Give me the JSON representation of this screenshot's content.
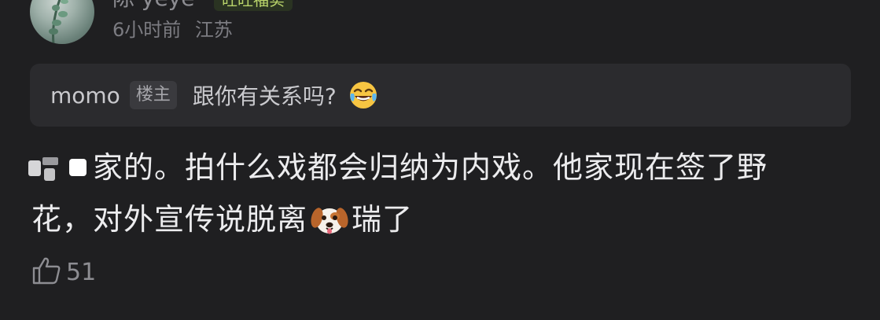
{
  "comment": {
    "username": "陈 yeye",
    "badge": "旺旺福实",
    "time": "6小时前",
    "location": "江苏",
    "quote": {
      "author": "momo",
      "op_tag": "楼主",
      "text": "跟你有关系吗?",
      "emoji": "tears-of-joy"
    },
    "body_line1": "家的。拍什么戏都会归纳为内戏。他家现在签了野",
    "body_line2a": "花，对外宣传说脱离",
    "body_emoji": "dog-face",
    "body_line2b": "瑞了",
    "likes": "51"
  },
  "colors": {
    "background": "#1f1f21",
    "quote_bg": "#2b2b2e",
    "badge_text": "#b8d36a"
  }
}
